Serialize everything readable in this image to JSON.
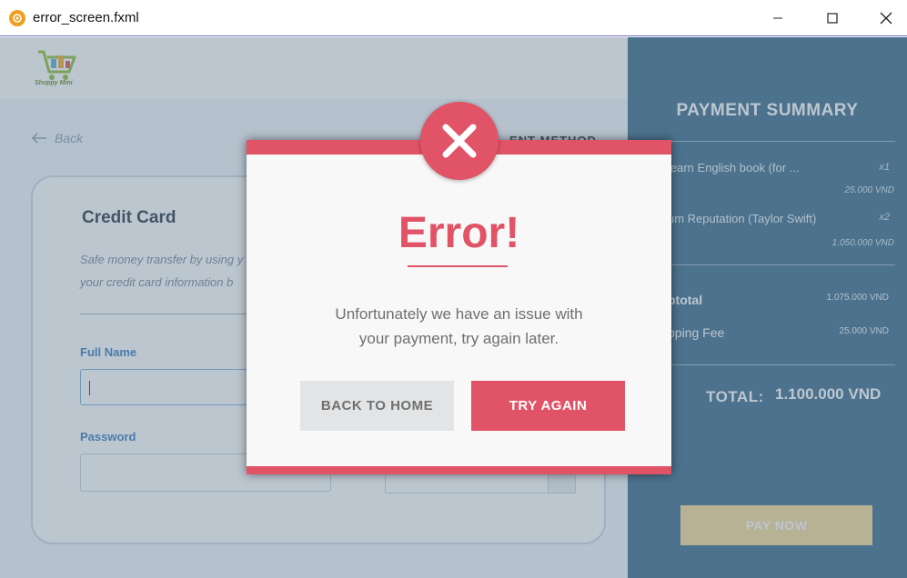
{
  "window": {
    "title": "error_screen.fxml",
    "controls": {
      "minimize_icon": "minimize-icon",
      "maximize_icon": "maximize-icon",
      "close_icon": "close-icon"
    }
  },
  "header": {
    "logo_text": "Shoppy Mini"
  },
  "navigation": {
    "back_label": "Back",
    "back_icon": "arrow-left-icon"
  },
  "payment_method": {
    "section_title_fragment": "ENT METHOD",
    "card_title": "Credit Card",
    "description_line1": "Safe money transfer by using y",
    "description_line2": "your credit card information b",
    "full_name_label": "Full Name",
    "full_name_value": "",
    "password_label": "Password",
    "password_value": ""
  },
  "payment_summary": {
    "title": "PAYMENT SUMMARY",
    "items": [
      {
        "name": "learn English book (for ...",
        "qty": "x1",
        "price": "25.000 VND"
      },
      {
        "name": "um Reputation (Taylor Swift)",
        "qty": "x2",
        "price": "1.050.000 VND"
      }
    ],
    "subtotal_label": "btotal",
    "subtotal_value": "1.075.000 VND",
    "shipping_label": "pping Fee",
    "shipping_value": "25.000 VND",
    "total_label": "TOTAL:",
    "total_value": "1.100.000 VND",
    "pay_button": "PAY NOW"
  },
  "dialog": {
    "icon": "error-x-icon",
    "title": "Error!",
    "message_line1": "Unfortunately we have an issue with",
    "message_line2": "your payment, try again later.",
    "back_button": "BACK TO HOME",
    "retry_button": "TRY AGAIN"
  },
  "colors": {
    "accent": "#e15366",
    "summary_panel": "#3e6f8e",
    "pay_button": "#f5dd98",
    "secondary_button": "#e3e4e6"
  }
}
